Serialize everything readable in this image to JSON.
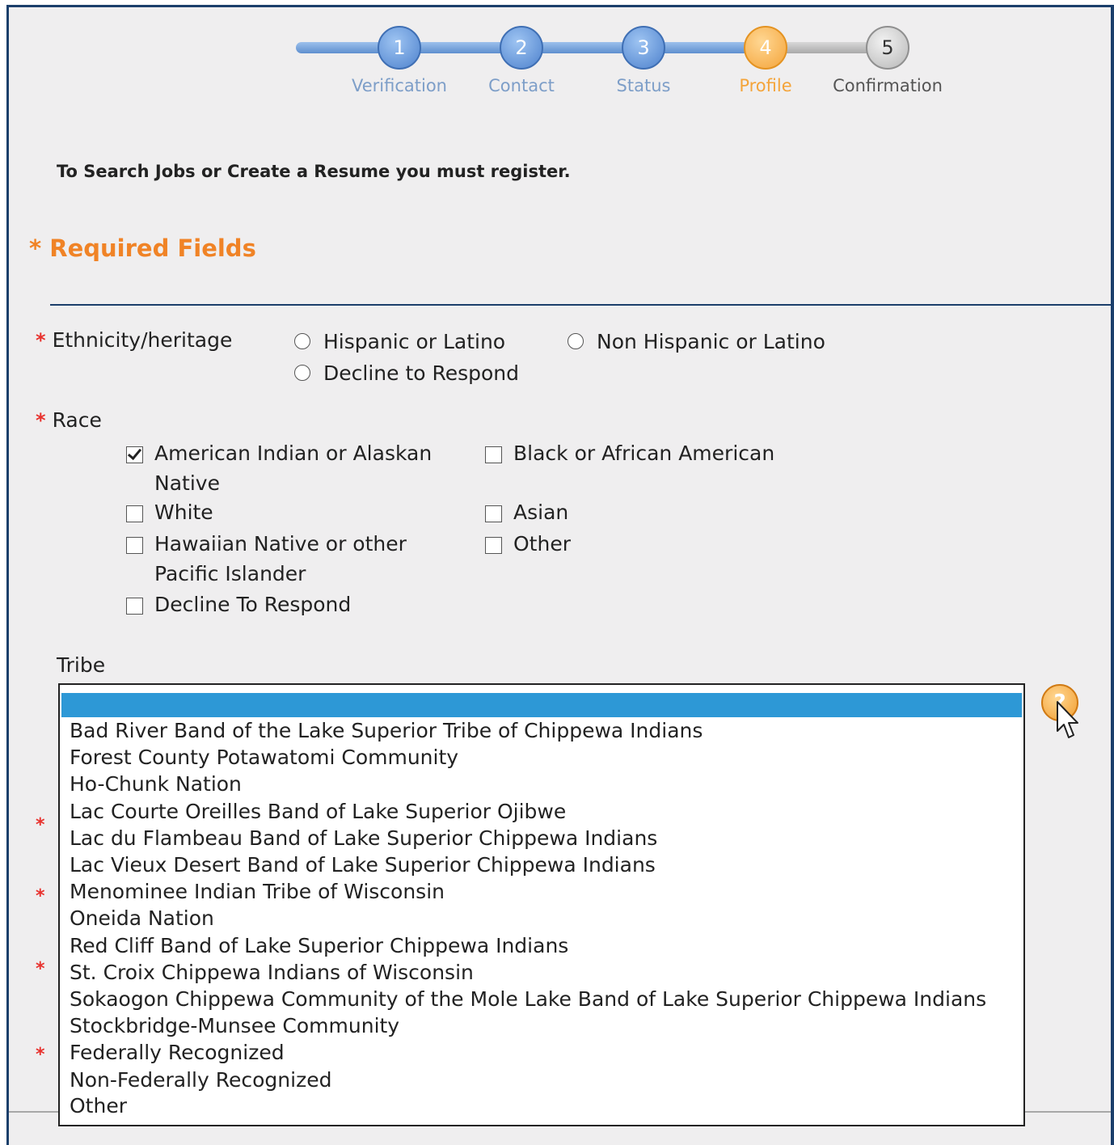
{
  "steps": [
    {
      "number": "1",
      "label": "Verification",
      "state": "done"
    },
    {
      "number": "2",
      "label": "Contact",
      "state": "done"
    },
    {
      "number": "3",
      "label": "Status",
      "state": "done"
    },
    {
      "number": "4",
      "label": "Profile",
      "state": "active"
    },
    {
      "number": "5",
      "label": "Confirmation",
      "state": "todo"
    }
  ],
  "intro": "To Search Jobs or Create a Resume you must register.",
  "required": {
    "star": "*",
    "title": "Required Fields"
  },
  "ethnicity": {
    "star": "*",
    "label": "Ethnicity/heritage",
    "options": [
      "Hispanic or Latino",
      "Non Hispanic or Latino",
      "Decline to Respond"
    ]
  },
  "race": {
    "star": "*",
    "label": "Race",
    "options": [
      {
        "label": "American Indian or Alaskan Native",
        "checked": true
      },
      {
        "label": "Black or African American",
        "checked": false
      },
      {
        "label": "White",
        "checked": false
      },
      {
        "label": "Asian",
        "checked": false
      },
      {
        "label": "Hawaiian Native or other Pacific Islander",
        "checked": false
      },
      {
        "label": "Other",
        "checked": false
      },
      {
        "label": "Decline To Respond",
        "checked": false
      }
    ]
  },
  "tribe": {
    "label": "Tribe",
    "selected": "",
    "options": [
      "Bad River Band of the Lake Superior Tribe of Chippewa Indians",
      "Forest County Potawatomi Community",
      "Ho-Chunk Nation",
      "Lac Courte Oreilles Band of Lake Superior Ojibwe",
      "Lac du Flambeau Band of Lake Superior Chippewa Indians",
      "Lac Vieux Desert Band of Lake Superior Chippewa Indians",
      "Menominee Indian Tribe of Wisconsin",
      "Oneida Nation",
      "Red Cliff Band of Lake Superior Chippewa Indians",
      "St. Croix Chippewa Indians of Wisconsin",
      "Sokaogon Chippewa Community of the Mole Lake Band of Lake Superior Chippewa Indians",
      "Stockbridge-Munsee Community",
      "Federally Recognized",
      "Non-Federally Recognized",
      "Other"
    ]
  },
  "hidden_stars": [
    "*",
    "*",
    "*",
    "*"
  ],
  "help": {
    "icon": "help-icon",
    "glyph": "?"
  },
  "colors": {
    "accent_orange": "#f08326",
    "step_blue": "#5f8fcf",
    "selection_blue": "#2d98d6",
    "frame_navy": "#1b3f6b",
    "required_red": "#e8322e"
  }
}
